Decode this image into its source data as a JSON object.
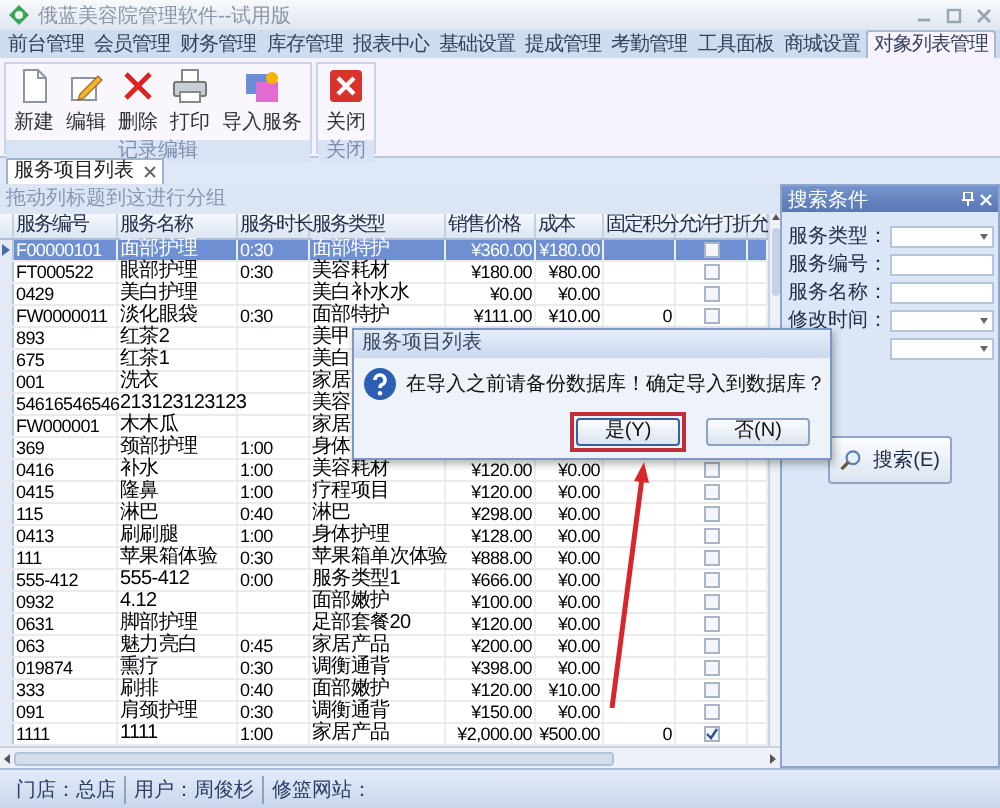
{
  "window": {
    "title": "俄蓝美容院管理软件--试用版"
  },
  "menu_tabs": [
    {
      "label": "前台管理",
      "selected": false
    },
    {
      "label": "会员管理",
      "selected": false
    },
    {
      "label": "财务管理",
      "selected": false
    },
    {
      "label": "库存管理",
      "selected": false
    },
    {
      "label": "报表中心",
      "selected": false
    },
    {
      "label": "基础设置",
      "selected": false
    },
    {
      "label": "提成管理",
      "selected": false
    },
    {
      "label": "考勤管理",
      "selected": false
    },
    {
      "label": "工具面板",
      "selected": false
    },
    {
      "label": "商城设置",
      "selected": false
    },
    {
      "label": "对象列表管理",
      "selected": true
    }
  ],
  "ribbon": {
    "groups": [
      {
        "label": "记录编辑",
        "buttons": [
          {
            "label": "新建",
            "kind": "new"
          },
          {
            "label": "编辑",
            "kind": "edit"
          },
          {
            "label": "删除",
            "kind": "delete"
          },
          {
            "label": "打印",
            "kind": "print"
          },
          {
            "label": "导入服务",
            "kind": "import"
          }
        ]
      },
      {
        "label": "关闭",
        "buttons": [
          {
            "label": "关闭",
            "kind": "close"
          }
        ]
      }
    ]
  },
  "document_tab": {
    "label": "服务项目列表"
  },
  "grid": {
    "group_hint": "拖动列标题到这进行分组",
    "columns": [
      "服务编号",
      "服务名称",
      "服务时长",
      "服务类型",
      "销售价格",
      "成本",
      "固定积分",
      "允许打折",
      "允"
    ],
    "rows": [
      {
        "selected": true,
        "service_code": "F00000101",
        "service_name": "面部护理",
        "duration": "0:30",
        "service_type": "面部特护",
        "price": "¥360.00",
        "cost": "¥180.00",
        "allow_discount": false
      },
      {
        "selected": false,
        "service_code": "FT000522",
        "service_name": "眼部护理",
        "duration": "0:30",
        "service_type": "美容耗材",
        "price": "¥180.00",
        "cost": "¥80.00",
        "allow_discount": false
      },
      {
        "selected": false,
        "service_code": "0429",
        "service_name": "美白护理",
        "service_type": "美白补水水",
        "price": "¥0.00",
        "cost": "¥0.00",
        "allow_discount": false
      },
      {
        "selected": false,
        "service_code": "FW0000011",
        "service_name": "淡化眼袋",
        "duration": "0:30",
        "service_type": "面部特护",
        "price": "¥111.00",
        "cost": "¥10.00",
        "points": "0",
        "allow_discount": false
      },
      {
        "selected": false,
        "service_code": "893",
        "service_name": "红茶2",
        "service_type": "美甲"
      },
      {
        "selected": false,
        "service_code": "675",
        "service_name": "红茶1",
        "service_type": "美白"
      },
      {
        "selected": false,
        "service_code": "001",
        "service_name": "洗衣",
        "service_type": "家居"
      },
      {
        "selected": false,
        "service_code": "54616546546",
        "service_name": "213123123123",
        "service_type": "美容"
      },
      {
        "selected": false,
        "service_code": "FW000001",
        "service_name": "木木瓜",
        "service_type": "家居"
      },
      {
        "selected": false,
        "service_code": "369",
        "service_name": "颈部护理",
        "duration": "1:00",
        "service_type": "身体"
      },
      {
        "selected": false,
        "service_code": "0416",
        "service_name": "补水",
        "duration": "1:00",
        "service_type": "美容耗材",
        "price": "¥120.00",
        "cost": "¥0.00",
        "allow_discount": false
      },
      {
        "selected": false,
        "service_code": "0415",
        "service_name": "隆鼻",
        "duration": "1:00",
        "service_type": "疗程项目",
        "price": "¥120.00",
        "cost": "¥0.00",
        "allow_discount": false
      },
      {
        "selected": false,
        "service_code": "115",
        "service_name": "淋巴",
        "duration": "0:40",
        "service_type": "淋巴",
        "price": "¥298.00",
        "cost": "¥0.00",
        "allow_discount": false
      },
      {
        "selected": false,
        "service_code": "0413",
        "service_name": "刷刷腿",
        "duration": "1:00",
        "service_type": "身体护理",
        "price": "¥128.00",
        "cost": "¥0.00",
        "allow_discount": false
      },
      {
        "selected": false,
        "service_code": "111",
        "service_name": "苹果箱体验",
        "duration": "0:30",
        "service_type": "苹果箱单次体验",
        "price": "¥888.00",
        "cost": "¥0.00",
        "allow_discount": false
      },
      {
        "selected": false,
        "service_code": "555-412",
        "service_name": "555-412",
        "duration": "0:00",
        "service_type": "服务类型1",
        "price": "¥666.00",
        "cost": "¥0.00",
        "allow_discount": false
      },
      {
        "selected": false,
        "service_code": "0932",
        "service_name": "4.12",
        "service_type": "面部嫩护",
        "price": "¥100.00",
        "cost": "¥0.00",
        "allow_discount": false
      },
      {
        "selected": false,
        "service_code": "0631",
        "service_name": "脚部护理",
        "service_type": "足部套餐20",
        "price": "¥120.00",
        "cost": "¥0.00",
        "allow_discount": false
      },
      {
        "selected": false,
        "service_code": "063",
        "service_name": "魅力亮白",
        "duration": "0:45",
        "service_type": "家居产品",
        "price": "¥200.00",
        "cost": "¥0.00",
        "allow_discount": false
      },
      {
        "selected": false,
        "service_code": "019874",
        "service_name": "熏疗",
        "duration": "0:30",
        "service_type": "调衡通背",
        "price": "¥398.00",
        "cost": "¥0.00",
        "allow_discount": false
      },
      {
        "selected": false,
        "service_code": "333",
        "service_name": "刷排",
        "duration": "0:40",
        "service_type": "面部嫩护",
        "price": "¥120.00",
        "cost": "¥10.00",
        "allow_discount": false
      },
      {
        "selected": false,
        "service_code": "091",
        "service_name": "肩颈护理",
        "duration": "0:30",
        "service_type": "调衡通背",
        "price": "¥150.00",
        "cost": "¥0.00",
        "allow_discount": false
      },
      {
        "selected": false,
        "service_code": "1111",
        "service_name": "1111",
        "duration": "1:00",
        "service_type": "家居产品",
        "price": "¥2,000.00",
        "cost": "¥500.00",
        "points": "0",
        "allow_discount": true
      }
    ]
  },
  "search_panel": {
    "title": "搜索条件",
    "fields": [
      {
        "label": "服务类型：",
        "kind": "dropdown"
      },
      {
        "label": "服务编号：",
        "kind": "text"
      },
      {
        "label": "服务名称：",
        "kind": "text"
      },
      {
        "label": "修改时间：",
        "kind": "dropdown"
      },
      {
        "kind": "dropdown"
      }
    ],
    "search_button": "搜索(E)"
  },
  "dialog": {
    "title": "服务项目列表",
    "message": "在导入之前请备份数据库！确定导入到数据库？",
    "buttons": [
      {
        "label": "是(Y)",
        "focused": true
      },
      {
        "label": "否(N)",
        "focused": false
      }
    ]
  },
  "status_bar": {
    "items": [
      "门店：总店",
      "用户：周俊杉",
      "修篮网站："
    ]
  }
}
